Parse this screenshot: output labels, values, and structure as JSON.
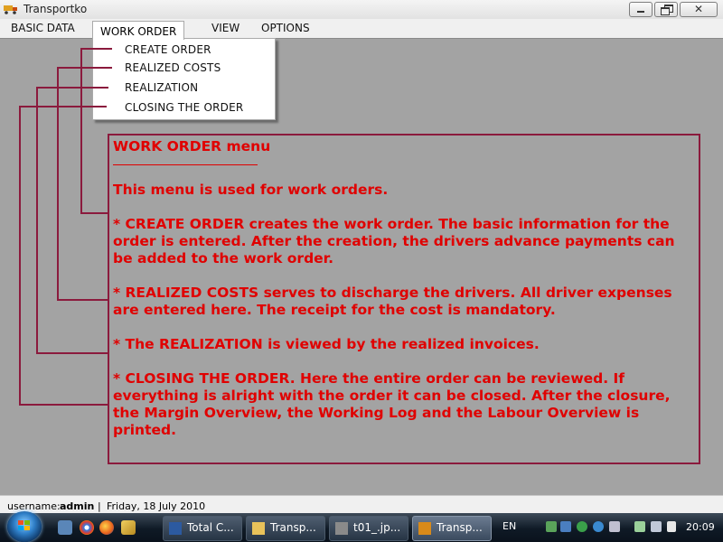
{
  "window": {
    "title": "Transportko"
  },
  "menubar": {
    "items": [
      "BASIC DATA",
      "WORK ORDER",
      "VIEW",
      "OPTIONS"
    ],
    "active": "WORK ORDER"
  },
  "dropdown": {
    "items": [
      "CREATE ORDER",
      "REALIZED COSTS",
      "REALIZATION",
      "CLOSING THE ORDER"
    ]
  },
  "help": {
    "heading": "WORK ORDER menu",
    "intro": "This menu is used for work orders.",
    "paragraphs": [
      "* CREATE ORDER creates the work order. The basic information for the order is entered. After the creation, the drivers advance payments can be added to the work order.",
      "* REALIZED COSTS serves to discharge the drivers. All driver expenses are entered here. The receipt for the cost is mandatory.",
      "* The REALIZATION is viewed by the realized invoices.",
      "* CLOSING THE ORDER. Here the entire order can be reviewed. If everything is alright with the order it can be closed. After the closure, the Margin Overview, the Working Log and the Labour Overview is printed."
    ],
    "text_color": "#e00000",
    "border_color": "#8b1a3d"
  },
  "statusbar": {
    "user_label": "username:",
    "user": "admin",
    "separator": "|",
    "date": "Friday, 18 July 2010"
  },
  "taskbar": {
    "tasks": [
      "Total C...",
      "Transp...",
      "t01_.jp...",
      "Transp..."
    ],
    "active_task": "Transp...",
    "language": "EN",
    "clock": "20:09"
  }
}
